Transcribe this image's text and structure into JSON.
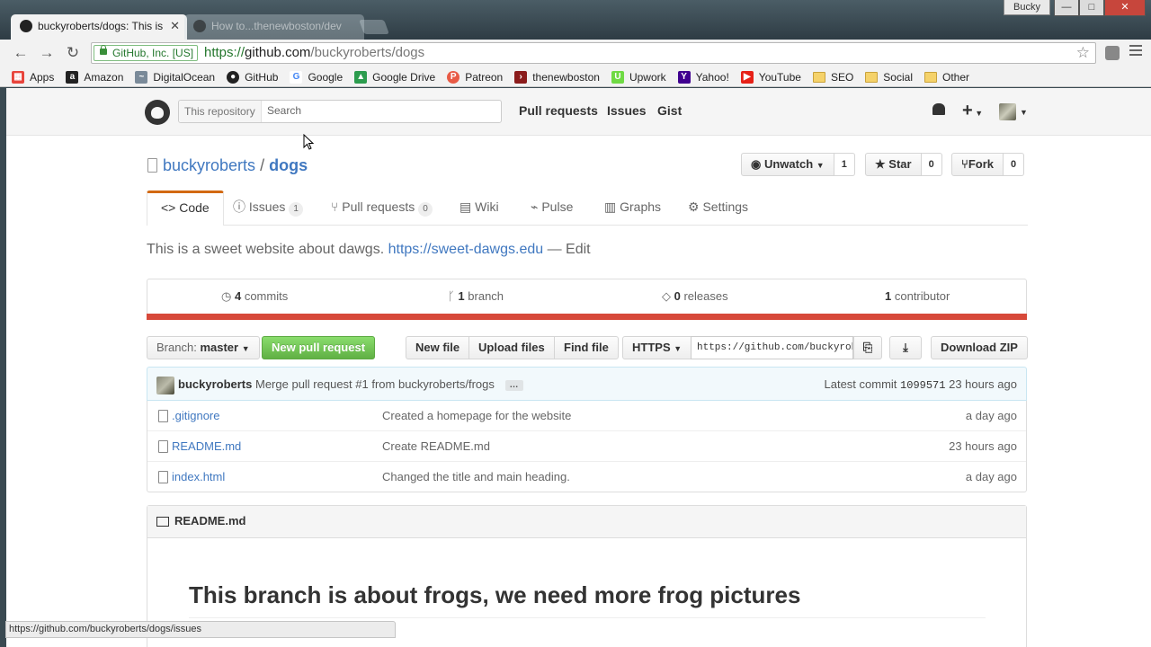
{
  "browser": {
    "tabs": [
      {
        "title": "buckyroberts/dogs: This is"
      },
      {
        "title": "How to...thenewboston/dev"
      }
    ],
    "profile": "Bucky",
    "window_buttons": {
      "minimize": "—",
      "maximize": "□",
      "close": "✕"
    },
    "security_badge": "GitHub, Inc. [US]",
    "url": {
      "protocol": "https://",
      "host": "github.com",
      "path": "/buckyroberts/dogs"
    },
    "bookmarks": [
      {
        "label": "Apps",
        "icon": "apps-grid-icon",
        "color": "#e8453c"
      },
      {
        "label": "Amazon",
        "icon": "amazon-icon",
        "color": "#222222"
      },
      {
        "label": "DigitalOcean",
        "icon": "digitalocean-icon",
        "color": "#7a8a99"
      },
      {
        "label": "GitHub",
        "icon": "github-icon",
        "color": "#222222"
      },
      {
        "label": "Google",
        "icon": "google-icon",
        "color": "#4285f4"
      },
      {
        "label": "Google Drive",
        "icon": "google-drive-icon",
        "color": "#2c9c4e"
      },
      {
        "label": "Patreon",
        "icon": "patreon-icon",
        "color": "#e85b46"
      },
      {
        "label": "thenewboston",
        "icon": "thenewboston-icon",
        "color": "#8b1c1c"
      },
      {
        "label": "Upwork",
        "icon": "upwork-icon",
        "color": "#6fda44"
      },
      {
        "label": "Yahoo!",
        "icon": "yahoo-icon",
        "color": "#400090"
      },
      {
        "label": "YouTube",
        "icon": "youtube-icon",
        "color": "#e62117"
      },
      {
        "label": "SEO",
        "icon": "folder-icon",
        "color": "#f5d26a"
      },
      {
        "label": "Social",
        "icon": "folder-icon",
        "color": "#f5d26a"
      },
      {
        "label": "Other",
        "icon": "folder-icon",
        "color": "#f5d26a"
      }
    ],
    "status_url": "https://github.com/buckyroberts/dogs/issues"
  },
  "header": {
    "search_scope": "This repository",
    "search_placeholder": "Search",
    "nav": [
      "Pull requests",
      "Issues",
      "Gist"
    ]
  },
  "repo": {
    "owner": "buckyroberts",
    "separator": "/",
    "name": "dogs",
    "watch_label": "Unwatch",
    "watch_count": "1",
    "star_label": "Star",
    "star_count": "0",
    "fork_label": "Fork",
    "fork_count": "0",
    "tabs": [
      {
        "label": "Code",
        "icon": "code-icon"
      },
      {
        "label": "Issues",
        "badge": "1",
        "icon": "issue-icon"
      },
      {
        "label": "Pull requests",
        "badge": "0",
        "icon": "pull-request-icon"
      },
      {
        "label": "Wiki",
        "icon": "wiki-icon"
      },
      {
        "label": "Pulse",
        "icon": "pulse-icon"
      },
      {
        "label": "Graphs",
        "icon": "graph-icon"
      },
      {
        "label": "Settings",
        "icon": "gear-icon"
      }
    ],
    "description": "This is a sweet website about dawgs.",
    "website": "https://sweet-dawgs.edu",
    "edit_label": "— Edit",
    "stats": {
      "commits_count": "4",
      "commits_label": "commits",
      "branch_count": "1",
      "branch_label": "branch",
      "releases_count": "0",
      "releases_label": "releases",
      "contributor_count": "1",
      "contributor_label": "contributor"
    },
    "language_color": "#d7493a"
  },
  "file_nav": {
    "branch_prefix": "Branch:",
    "branch": "master",
    "new_pull_request": "New pull request",
    "new_file": "New file",
    "upload_files": "Upload files",
    "find_file": "Find file",
    "protocol": "HTTPS",
    "clone_url": "https://github.com/buckyroberts/dogs.git",
    "download_zip": "Download ZIP"
  },
  "latest_commit": {
    "author": "buckyroberts",
    "message": "Merge pull request #1 from buckyroberts/frogs",
    "ellipsis": "…",
    "label": "Latest commit",
    "sha": "1099571",
    "age": "23 hours ago"
  },
  "files": [
    {
      "name": ".gitignore",
      "message": "Created a homepage for the website",
      "age": "a day ago"
    },
    {
      "name": "README.md",
      "message": "Create README.md",
      "age": "23 hours ago"
    },
    {
      "name": "index.html",
      "message": "Changed the title and main heading.",
      "age": "a day ago"
    }
  ],
  "readme": {
    "title": "README.md",
    "heading": "This branch is about frogs, we need more frog pictures"
  }
}
